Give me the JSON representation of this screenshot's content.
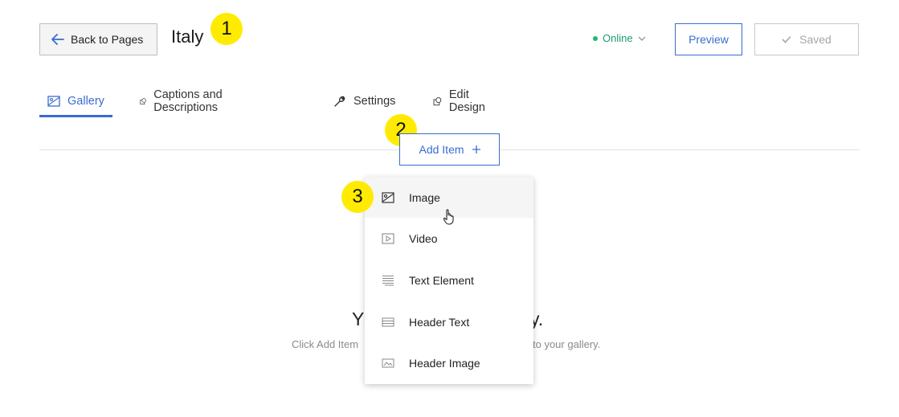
{
  "header": {
    "back_label": "Back to Pages",
    "page_title": "Italy",
    "status_label": "Online",
    "preview_label": "Preview",
    "saved_label": "Saved"
  },
  "annotations": [
    "1",
    "2",
    "3"
  ],
  "tabs": [
    {
      "label": "Gallery",
      "icon": "image-icon",
      "active": true
    },
    {
      "label": "Captions and Descriptions",
      "icon": "shapes-icon",
      "active": false
    },
    {
      "label": "Settings",
      "icon": "wrench-icon",
      "active": false
    },
    {
      "label": "Edit Design",
      "icon": "shapes-icon",
      "active": false
    }
  ],
  "add_item": {
    "label": "Add Item"
  },
  "dropdown": {
    "items": [
      {
        "label": "Image",
        "icon": "image-icon"
      },
      {
        "label": "Video",
        "icon": "video-icon"
      },
      {
        "label": "Text Element",
        "icon": "text-lines-icon"
      },
      {
        "label": "Header Text",
        "icon": "header-text-icon"
      },
      {
        "label": "Header Image",
        "icon": "header-image-icon"
      }
    ]
  },
  "empty_state": {
    "heading_left": "Y",
    "heading_right": "y.",
    "sub_left": "Click Add Item",
    "sub_right": "to your gallery."
  },
  "colors": {
    "accent": "#3a6bd1",
    "online": "#22b573",
    "badge": "#ffeb00"
  }
}
